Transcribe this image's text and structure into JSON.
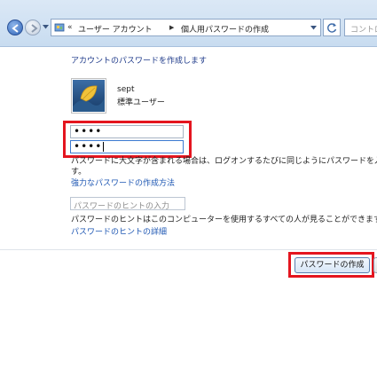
{
  "address_bar": {
    "overflow_glyph": "«",
    "crumbs": [
      "ユーザー アカウント",
      "個人用パスワードの作成"
    ],
    "search_placeholder": "コントロー"
  },
  "page": {
    "heading": "アカウントのパスワードを作成します",
    "user": {
      "name": "sept",
      "account_type": "標準ユーザー"
    },
    "new_password": {
      "value": "••••"
    },
    "confirm_password": {
      "value": "••••"
    },
    "info_line1": "パスワードに大文字が含まれる場合は、ログオンするたびに同じようにパスワードを入力す",
    "info_line2": "す。",
    "strong_password_link": "強力なパスワードの作成方法",
    "hint_placeholder": "パスワードのヒントの入力",
    "hint_info": "パスワードのヒントはこのコンピューターを使用するすべての人が見ることができます。",
    "hint_details_link": "パスワードのヒントの詳細",
    "create_button": "パスワードの作成"
  },
  "icons": {
    "back": "back-arrow-icon",
    "forward": "forward-arrow-icon",
    "control_panel": "control-panel-icon",
    "refresh": "refresh-icon",
    "avatar": "user-avatar-icon"
  },
  "colors": {
    "highlight": "#e4151f",
    "link": "#1e57b3",
    "heading": "#1e3a8a"
  }
}
